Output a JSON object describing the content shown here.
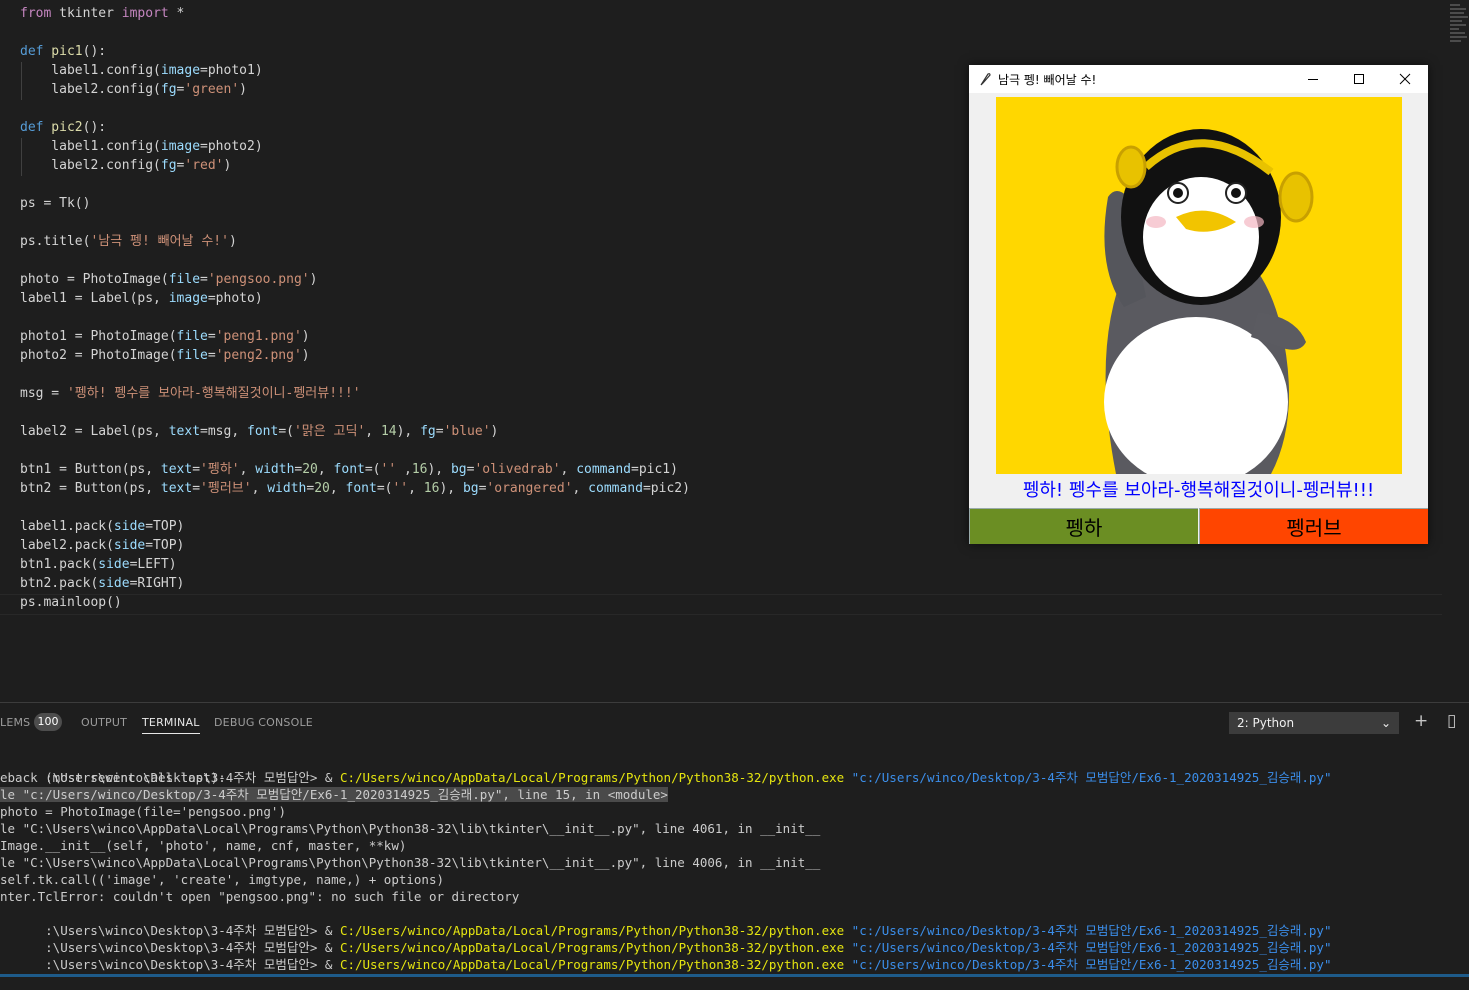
{
  "editor": {
    "lines": [
      [
        {
          "t": "from",
          "c": "#c586c0"
        },
        {
          "t": " tkinter ",
          "c": "#d4d4d4"
        },
        {
          "t": "import",
          "c": "#c586c0"
        },
        {
          "t": " *",
          "c": "#d4d4d4"
        }
      ],
      [],
      [
        {
          "t": "def",
          "c": "#569cd6"
        },
        {
          "t": " pic1",
          "c": "#dcdcaa"
        },
        {
          "t": "():",
          "c": "#d4d4d4"
        }
      ],
      [
        {
          "t": "    label1.config(",
          "c": "#d4d4d4"
        },
        {
          "t": "image",
          "c": "#9cdcfe"
        },
        {
          "t": "=photo1)",
          "c": "#d4d4d4"
        }
      ],
      [
        {
          "t": "    label2.config(",
          "c": "#d4d4d4"
        },
        {
          "t": "fg",
          "c": "#9cdcfe"
        },
        {
          "t": "=",
          "c": "#d4d4d4"
        },
        {
          "t": "'green'",
          "c": "#ce9178"
        },
        {
          "t": ")",
          "c": "#d4d4d4"
        }
      ],
      [],
      [
        {
          "t": "def",
          "c": "#569cd6"
        },
        {
          "t": " pic2",
          "c": "#dcdcaa"
        },
        {
          "t": "():",
          "c": "#d4d4d4"
        }
      ],
      [
        {
          "t": "    label1.config(",
          "c": "#d4d4d4"
        },
        {
          "t": "image",
          "c": "#9cdcfe"
        },
        {
          "t": "=photo2)",
          "c": "#d4d4d4"
        }
      ],
      [
        {
          "t": "    label2.config(",
          "c": "#d4d4d4"
        },
        {
          "t": "fg",
          "c": "#9cdcfe"
        },
        {
          "t": "=",
          "c": "#d4d4d4"
        },
        {
          "t": "'red'",
          "c": "#ce9178"
        },
        {
          "t": ")",
          "c": "#d4d4d4"
        }
      ],
      [],
      [
        {
          "t": "ps = Tk()",
          "c": "#d4d4d4"
        }
      ],
      [],
      [
        {
          "t": "ps.title(",
          "c": "#d4d4d4"
        },
        {
          "t": "'남극 펭! 빼어날 수!'",
          "c": "#ce9178"
        },
        {
          "t": ")",
          "c": "#d4d4d4"
        }
      ],
      [],
      [
        {
          "t": "photo = PhotoImage(",
          "c": "#d4d4d4"
        },
        {
          "t": "file",
          "c": "#9cdcfe"
        },
        {
          "t": "=",
          "c": "#d4d4d4"
        },
        {
          "t": "'pengsoo.png'",
          "c": "#ce9178"
        },
        {
          "t": ")",
          "c": "#d4d4d4"
        }
      ],
      [
        {
          "t": "label1 = Label(ps, ",
          "c": "#d4d4d4"
        },
        {
          "t": "image",
          "c": "#9cdcfe"
        },
        {
          "t": "=photo)",
          "c": "#d4d4d4"
        }
      ],
      [],
      [
        {
          "t": "photo1 = PhotoImage(",
          "c": "#d4d4d4"
        },
        {
          "t": "file",
          "c": "#9cdcfe"
        },
        {
          "t": "=",
          "c": "#d4d4d4"
        },
        {
          "t": "'peng1.png'",
          "c": "#ce9178"
        },
        {
          "t": ")",
          "c": "#d4d4d4"
        }
      ],
      [
        {
          "t": "photo2 = PhotoImage(",
          "c": "#d4d4d4"
        },
        {
          "t": "file",
          "c": "#9cdcfe"
        },
        {
          "t": "=",
          "c": "#d4d4d4"
        },
        {
          "t": "'peng2.png'",
          "c": "#ce9178"
        },
        {
          "t": ")",
          "c": "#d4d4d4"
        }
      ],
      [],
      [
        {
          "t": "msg = ",
          "c": "#d4d4d4"
        },
        {
          "t": "'펭하! 펭수를 보아라-행복해질것이니-펭러뷰!!!'",
          "c": "#ce9178"
        }
      ],
      [],
      [
        {
          "t": "label2 = Label(ps, ",
          "c": "#d4d4d4"
        },
        {
          "t": "text",
          "c": "#9cdcfe"
        },
        {
          "t": "=msg, ",
          "c": "#d4d4d4"
        },
        {
          "t": "font",
          "c": "#9cdcfe"
        },
        {
          "t": "=(",
          "c": "#d4d4d4"
        },
        {
          "t": "'맑은 고딕'",
          "c": "#ce9178"
        },
        {
          "t": ", ",
          "c": "#d4d4d4"
        },
        {
          "t": "14",
          "c": "#b5cea8"
        },
        {
          "t": "), ",
          "c": "#d4d4d4"
        },
        {
          "t": "fg",
          "c": "#9cdcfe"
        },
        {
          "t": "=",
          "c": "#d4d4d4"
        },
        {
          "t": "'blue'",
          "c": "#ce9178"
        },
        {
          "t": ")",
          "c": "#d4d4d4"
        }
      ],
      [],
      [
        {
          "t": "btn1 = Button(ps, ",
          "c": "#d4d4d4"
        },
        {
          "t": "text",
          "c": "#9cdcfe"
        },
        {
          "t": "=",
          "c": "#d4d4d4"
        },
        {
          "t": "'펭하'",
          "c": "#ce9178"
        },
        {
          "t": ", ",
          "c": "#d4d4d4"
        },
        {
          "t": "width",
          "c": "#9cdcfe"
        },
        {
          "t": "=",
          "c": "#d4d4d4"
        },
        {
          "t": "20",
          "c": "#b5cea8"
        },
        {
          "t": ", ",
          "c": "#d4d4d4"
        },
        {
          "t": "font",
          "c": "#9cdcfe"
        },
        {
          "t": "=(",
          "c": "#d4d4d4"
        },
        {
          "t": "''",
          "c": "#ce9178"
        },
        {
          "t": " ,",
          "c": "#d4d4d4"
        },
        {
          "t": "16",
          "c": "#b5cea8"
        },
        {
          "t": "), ",
          "c": "#d4d4d4"
        },
        {
          "t": "bg",
          "c": "#9cdcfe"
        },
        {
          "t": "=",
          "c": "#d4d4d4"
        },
        {
          "t": "'olivedrab'",
          "c": "#ce9178"
        },
        {
          "t": ", ",
          "c": "#d4d4d4"
        },
        {
          "t": "command",
          "c": "#9cdcfe"
        },
        {
          "t": "=pic1)",
          "c": "#d4d4d4"
        }
      ],
      [
        {
          "t": "btn2 = Button(ps, ",
          "c": "#d4d4d4"
        },
        {
          "t": "text",
          "c": "#9cdcfe"
        },
        {
          "t": "=",
          "c": "#d4d4d4"
        },
        {
          "t": "'펭러브'",
          "c": "#ce9178"
        },
        {
          "t": ", ",
          "c": "#d4d4d4"
        },
        {
          "t": "width",
          "c": "#9cdcfe"
        },
        {
          "t": "=",
          "c": "#d4d4d4"
        },
        {
          "t": "20",
          "c": "#b5cea8"
        },
        {
          "t": ", ",
          "c": "#d4d4d4"
        },
        {
          "t": "font",
          "c": "#9cdcfe"
        },
        {
          "t": "=(",
          "c": "#d4d4d4"
        },
        {
          "t": "''",
          "c": "#ce9178"
        },
        {
          "t": ", ",
          "c": "#d4d4d4"
        },
        {
          "t": "16",
          "c": "#b5cea8"
        },
        {
          "t": "), ",
          "c": "#d4d4d4"
        },
        {
          "t": "bg",
          "c": "#9cdcfe"
        },
        {
          "t": "=",
          "c": "#d4d4d4"
        },
        {
          "t": "'orangered'",
          "c": "#ce9178"
        },
        {
          "t": ", ",
          "c": "#d4d4d4"
        },
        {
          "t": "command",
          "c": "#9cdcfe"
        },
        {
          "t": "=pic2)",
          "c": "#d4d4d4"
        }
      ],
      [],
      [
        {
          "t": "label1.pack(",
          "c": "#d4d4d4"
        },
        {
          "t": "side",
          "c": "#9cdcfe"
        },
        {
          "t": "=TOP)",
          "c": "#d4d4d4"
        }
      ],
      [
        {
          "t": "label2.pack(",
          "c": "#d4d4d4"
        },
        {
          "t": "side",
          "c": "#9cdcfe"
        },
        {
          "t": "=TOP)",
          "c": "#d4d4d4"
        }
      ],
      [
        {
          "t": "btn1.pack(",
          "c": "#d4d4d4"
        },
        {
          "t": "side",
          "c": "#9cdcfe"
        },
        {
          "t": "=LEFT)",
          "c": "#d4d4d4"
        }
      ],
      [
        {
          "t": "btn2.pack(",
          "c": "#d4d4d4"
        },
        {
          "t": "side",
          "c": "#9cdcfe"
        },
        {
          "t": "=RIGHT)",
          "c": "#d4d4d4"
        }
      ],
      [
        {
          "t": "ps.mainloop()",
          "c": "#d4d4d4"
        }
      ]
    ]
  },
  "tk_window": {
    "title": "남극 펭! 빼어날 수!",
    "message": "펭하! 펭수를 보아라-행복해질것이니-펭러뷰!!!",
    "button1_label": "펭하",
    "button2_label": "펭러브",
    "button1_color": "#6b8e23",
    "button2_color": "#ff4500",
    "message_color": "#0000ff",
    "image_bg": "#ffd700"
  },
  "panel": {
    "tab_problems": "LEMS",
    "problems_count": "100",
    "tab_output": "OUTPUT",
    "tab_terminal": "TERMINAL",
    "tab_debug": "DEBUG CONSOLE",
    "terminal_select": "2: Python",
    "add_icon": "+",
    "split_icon": "▯"
  },
  "terminal": {
    "prompt": ":\\Users\\winco\\Desktop\\3-4주차 모범답안> & ",
    "exe": "C:/Users/winco/AppData/Local/Programs/Python/Python38-32/python.exe",
    "script": " \"c:/Users/winco/Desktop/3-4주차 모범답안/Ex6-1_2020314925_김승래.py\"",
    "traceback_lines": [
      "eback (most recent call last):",
      "le \"c:/Users/winco/Desktop/3-4주차 모범답안/Ex6-1_2020314925_김승래.py\", line 15, in <module>",
      "photo = PhotoImage(file='pengsoo.png')",
      "le \"C:\\Users\\winco\\AppData\\Local\\Programs\\Python\\Python38-32\\lib\\tkinter\\__init__.py\", line 4061, in __init__",
      "Image.__init__(self, 'photo', name, cnf, master, **kw)",
      "le \"C:\\Users\\winco\\AppData\\Local\\Programs\\Python\\Python38-32\\lib\\tkinter\\__init__.py\", line 4006, in __init__",
      "self.tk.call(('image', 'create', imgtype, name,) + options)",
      "nter.TclError: couldn't open \"pengsoo.png\": no such file or directory"
    ]
  }
}
